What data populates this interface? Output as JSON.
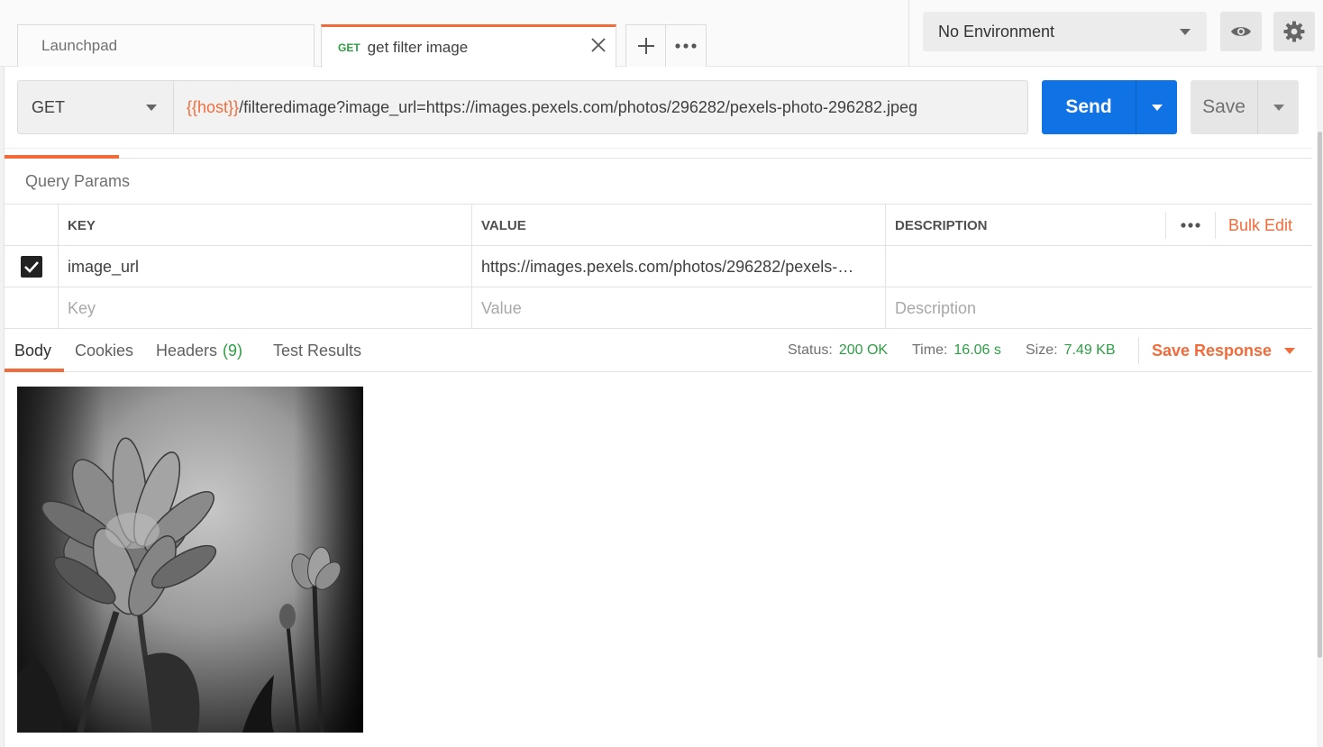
{
  "tabs": [
    {
      "label": "Launchpad"
    },
    {
      "method": "GET",
      "label": "get filter image"
    }
  ],
  "environment": {
    "selected": "No Environment"
  },
  "request": {
    "method": "GET",
    "url_var": "{{host}}",
    "url_rest": "/filteredimage?image_url=https://images.pexels.com/photos/296282/pexels-photo-296282.jpeg",
    "send_label": "Send",
    "save_label": "Save"
  },
  "params": {
    "title": "Query Params",
    "headers": {
      "key": "KEY",
      "value": "VALUE",
      "description": "DESCRIPTION"
    },
    "bulk_edit": "Bulk Edit",
    "rows": [
      {
        "checked": true,
        "key": "image_url",
        "value": "https://images.pexels.com/photos/296282/pexels-…",
        "description": ""
      }
    ],
    "placeholders": {
      "key": "Key",
      "value": "Value",
      "description": "Description"
    }
  },
  "response": {
    "tabs": {
      "body": "Body",
      "cookies": "Cookies",
      "headers": "Headers",
      "headers_count": "(9)",
      "tests": "Test Results"
    },
    "status_label": "Status:",
    "status": "200 OK",
    "time_label": "Time:",
    "time": "16.06 s",
    "size_label": "Size:",
    "size": "7.49 KB",
    "save_response": "Save Response"
  },
  "colors": {
    "accent": "#f26b3a",
    "send": "#0f72e5",
    "success": "#2e9e44"
  }
}
